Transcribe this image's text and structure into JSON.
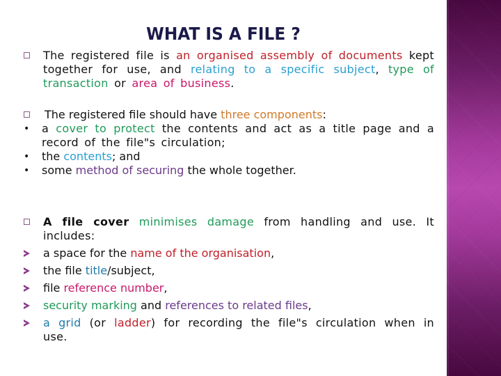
{
  "slide": {
    "title": "WHAT IS A FILE ?",
    "colors": {
      "title": "#1c1a4a",
      "red": "#c0202a",
      "cyan": "#2a9fd0",
      "green": "#1f9a5a",
      "pink": "#c8176a",
      "orange": "#d07a2a",
      "purple": "#6a3a8a",
      "teal": "#1e7aa8",
      "side_panel": "#a43a9c"
    }
  },
  "para1": {
    "bullet_icon": "square-bullet-icon",
    "s1": "The registered file is ",
    "s2": "an organised assembly of documents",
    "s3": " kept together for use, and ",
    "s4": "relating to a specific subject",
    "s5": ", ",
    "s6": "type of transaction",
    "s7": " or ",
    "s8": "area of business",
    "s9": "."
  },
  "para2": {
    "bullet_icon": "square-bullet-icon",
    "intro_s1": "The registered file should have ",
    "intro_s2": "three components",
    "intro_s3": ":",
    "items": [
      {
        "bullet": "•",
        "s1": "a ",
        "s2": "cover to protect",
        "s3": " the contents and act as a title page and a record of the file\"s circulation;"
      },
      {
        "bullet": "•",
        "s1": "the ",
        "s2": "contents",
        "s3": "; and"
      },
      {
        "bullet": "•",
        "s1": "some ",
        "s2": "method of securing",
        "s3": " the whole together."
      }
    ]
  },
  "para3": {
    "bullet_icon": "square-bullet-icon",
    "intro_s1": "A file cover",
    "intro_s2": " minimises damage",
    "intro_s3": " from handling and use. It includes:",
    "items": [
      {
        "bullet_icon": "arrow-bullet-icon",
        "s1": "a space for the ",
        "s2": "name of the organisation",
        "s3": ","
      },
      {
        "bullet_icon": "arrow-bullet-icon",
        "s1": "the file ",
        "s2": "title",
        "s3": "/subject,"
      },
      {
        "bullet_icon": "arrow-bullet-icon",
        "s1": "file ",
        "s2": "reference number",
        "s3": ","
      },
      {
        "bullet_icon": "arrow-bullet-icon",
        "s1": "security marking",
        "s2": " and ",
        "s3": "references to related files",
        "s4": ","
      },
      {
        "bullet_icon": "arrow-bullet-icon",
        "s1": "a grid",
        "s2": " (or ",
        "s3": "ladder",
        "s4": ") for recording the file\"s circulation when in use."
      }
    ]
  }
}
